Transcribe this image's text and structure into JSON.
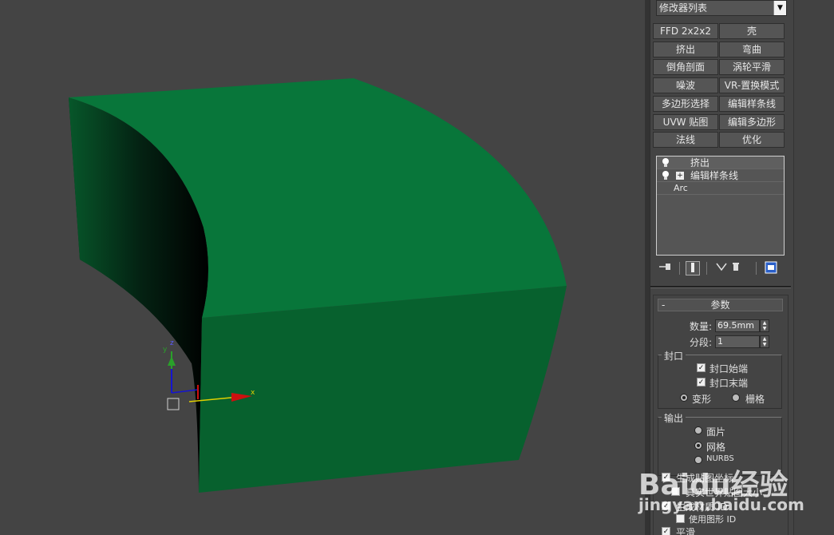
{
  "modifier_list": {
    "label": "修改器列表",
    "arrow": "▼"
  },
  "modifier_buttons": [
    [
      "FFD 2x2x2",
      "壳"
    ],
    [
      "挤出",
      "弯曲"
    ],
    [
      "倒角剖面",
      "涡轮平滑"
    ],
    [
      "噪波",
      "VR-置换模式"
    ],
    [
      "多边形选择",
      "编辑样条线"
    ],
    [
      "UVW 贴图",
      "编辑多边形"
    ],
    [
      "法线",
      "优化"
    ]
  ],
  "stack": {
    "items": [
      {
        "label": "挤出"
      },
      {
        "label": "编辑样条线",
        "expand": "+"
      },
      {
        "label": "Arc"
      }
    ]
  },
  "parameters": {
    "title": "参数",
    "collapse": "-",
    "amount_label": "数量:",
    "amount_value": "69.5mm",
    "segments_label": "分段:",
    "segments_value": "1",
    "capping": {
      "title": "封口",
      "cap_start": "封口始端",
      "cap_end": "封口末端",
      "morph": "变形",
      "grid": "栅格"
    },
    "output": {
      "title": "输出",
      "patch": "面片",
      "mesh": "网格",
      "nurbs": "NURBS"
    },
    "gen_mapping": "生成贴图坐标",
    "real_world": "真实世界贴图大小",
    "gen_mat_ids": "生成材质 ID",
    "use_shape_ids": "使用图形 ID",
    "smooth": "平滑"
  },
  "gizmo": {
    "x": "x",
    "y": "y",
    "z": "z"
  },
  "watermark": {
    "brand": "Baidu经验",
    "url": "jingyan.baidu.com"
  },
  "colors": {
    "viewport_bg": "#444444",
    "object_top": "#08763a",
    "object_front": "#07612e",
    "object_inner": "#052912"
  }
}
